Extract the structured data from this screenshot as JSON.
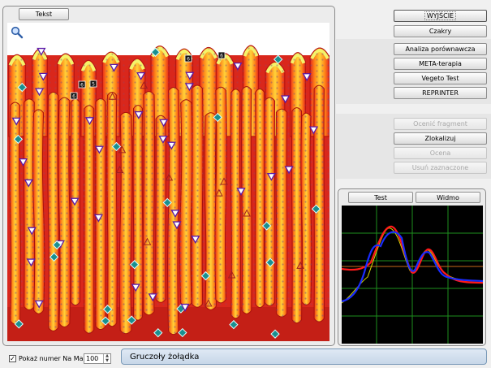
{
  "tissue_panel": {
    "tab_label": "Tekst"
  },
  "right_panel": {
    "exit_label": "WYJŚCIE",
    "menu": [
      {
        "label": "Czakry"
      },
      {
        "label": "Analiza porównawcza"
      },
      {
        "label": "META-terapia"
      },
      {
        "label": "Vegeto Test"
      },
      {
        "label": "REPRINTER"
      }
    ],
    "actions": [
      {
        "label": "Ocenić fragment",
        "enabled": false
      },
      {
        "label": "Zlokalizuj",
        "enabled": true
      },
      {
        "label": "Ocena",
        "enabled": false
      },
      {
        "label": "Usuń zaznaczone",
        "enabled": false
      }
    ]
  },
  "graph_panel": {
    "tabs": [
      {
        "label": "Test"
      },
      {
        "label": "Widmo"
      }
    ],
    "colors": {
      "blue": "#1a2cff",
      "red": "#ff1a1a",
      "yellow": "#d8d800",
      "grid": "#1e8f1e",
      "baseline": "#c86a1a"
    }
  },
  "marker_numbers": [
    "6",
    "6",
    "6",
    "6",
    "5"
  ],
  "bottom_bar": {
    "show_marker_label": "Pokaż numer Na Marker",
    "show_marker_checked": true,
    "marker_count": "100",
    "status_text": "Gruczoły żołądka"
  },
  "icons": {
    "zoom": "magnifier-icon"
  }
}
